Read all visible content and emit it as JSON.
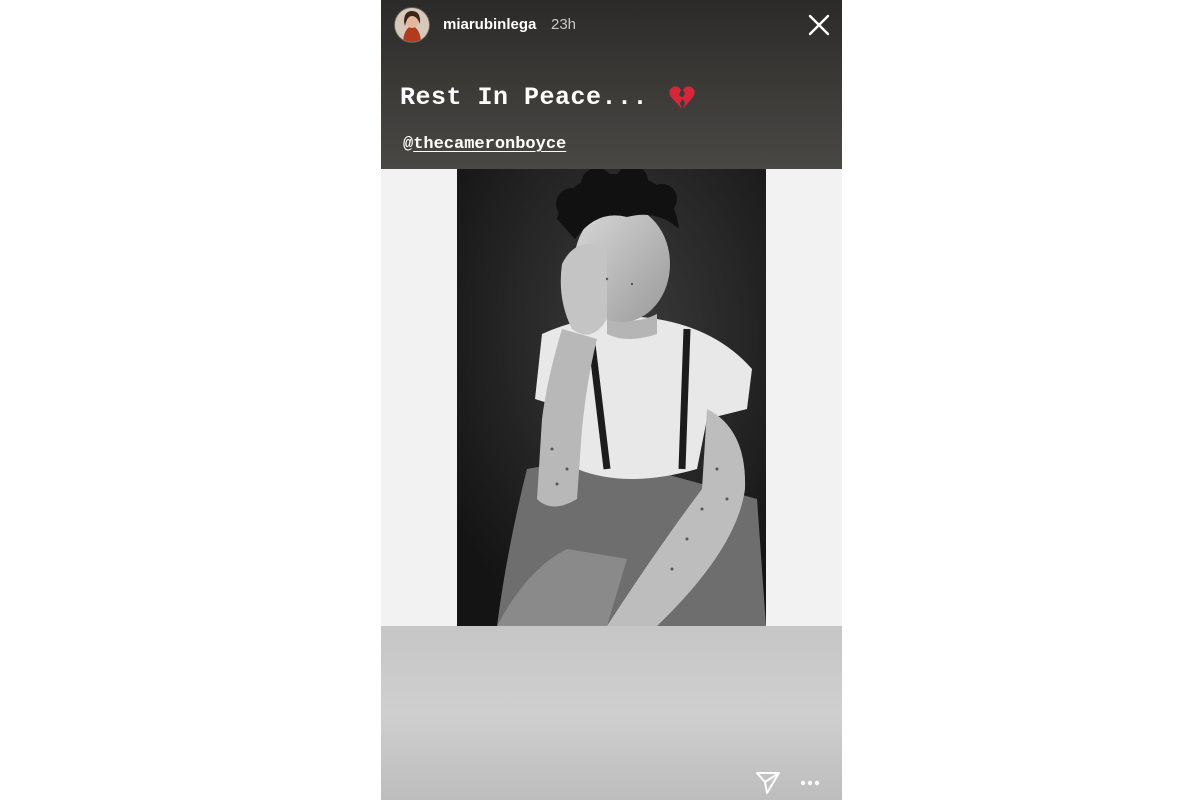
{
  "story": {
    "username": "miarubinlega",
    "timestamp": "23h",
    "caption": "Rest In Peace...",
    "caption_emoji": "broken-heart-icon",
    "mention_prefix": "@",
    "mention_handle": "thecameronboyce"
  },
  "icons": {
    "close": "close-icon",
    "send": "send-icon",
    "more": "more-options-icon"
  },
  "colors": {
    "top_background": "#3a3836",
    "side_background": "#f2f2f2",
    "bottom_background": "#c8c8c8",
    "text": "#ffffff",
    "heart": "#d6263a"
  }
}
